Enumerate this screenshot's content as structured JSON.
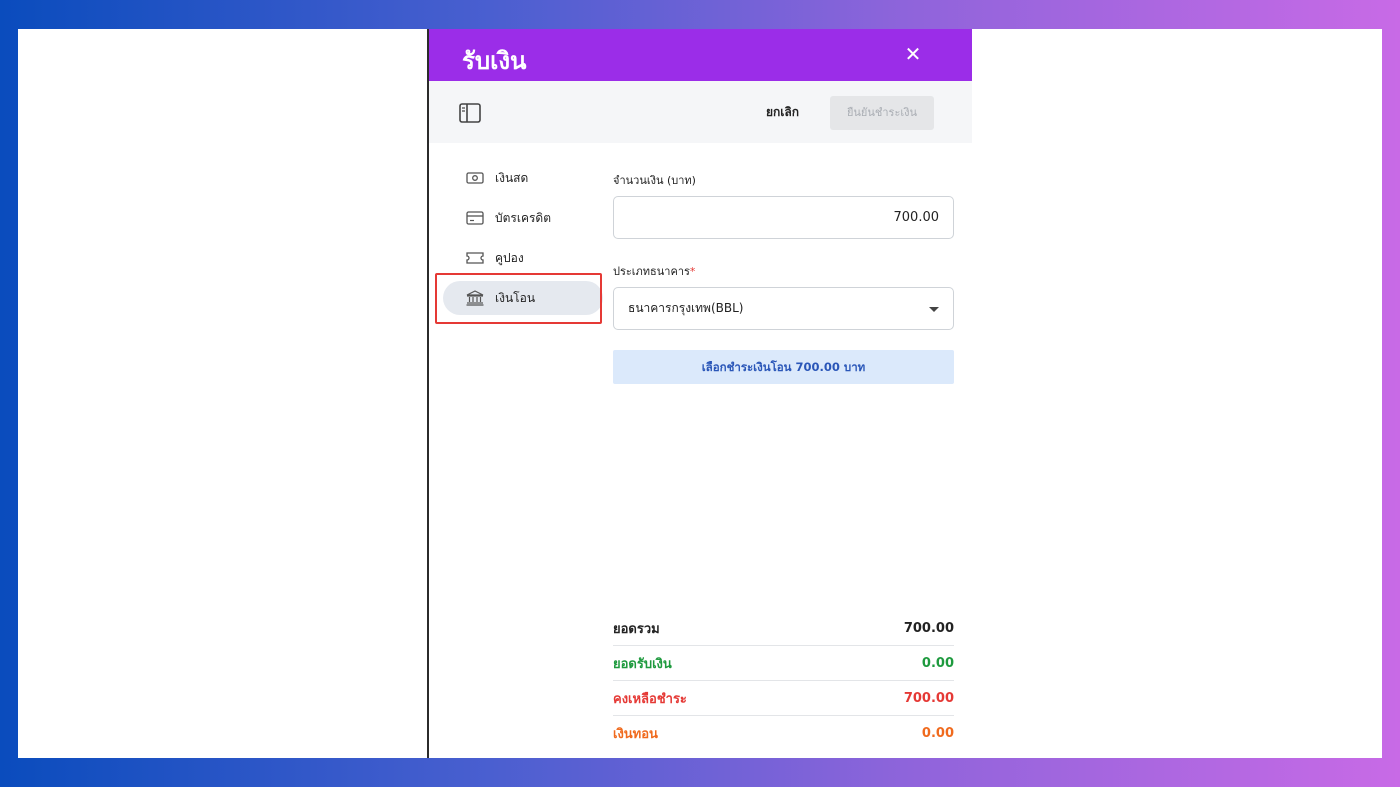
{
  "dialog": {
    "title": "รับเงิน",
    "close_symbol": "✕",
    "cancel_label": "ยกเลิก",
    "confirm_label": "ยืนยันชำระเงิน"
  },
  "payment_methods": [
    {
      "label": "เงินสด",
      "icon": "cash-icon",
      "active": false
    },
    {
      "label": "บัตรเครดิต",
      "icon": "credit-card-icon",
      "active": false
    },
    {
      "label": "คูปอง",
      "icon": "coupon-icon",
      "active": false
    },
    {
      "label": "เงินโอน",
      "icon": "bank-icon",
      "active": true
    }
  ],
  "form": {
    "amount_label": "จำนวนเงิน (บาท)",
    "amount_value": "700.00",
    "bank_label": "ประเภทธนาคาร",
    "required_mark": "*",
    "bank_selected": "ธนาคารกรุงเทพ(BBL)",
    "pay_button_label": "เลือกชำระเงินโอน 700.00 บาท"
  },
  "summary": [
    {
      "label": "ยอดรวม",
      "value": "700.00",
      "color": "#222222"
    },
    {
      "label": "ยอดรับเงิน",
      "value": "0.00",
      "color": "#1e9a3e"
    },
    {
      "label": "คงเหลือชำระ",
      "value": "700.00",
      "color": "#e53935"
    },
    {
      "label": "เงินทอน",
      "value": "0.00",
      "color": "#f06a1d"
    }
  ],
  "colors": {
    "header": "#9b2de8",
    "highlight": "#e53935"
  }
}
